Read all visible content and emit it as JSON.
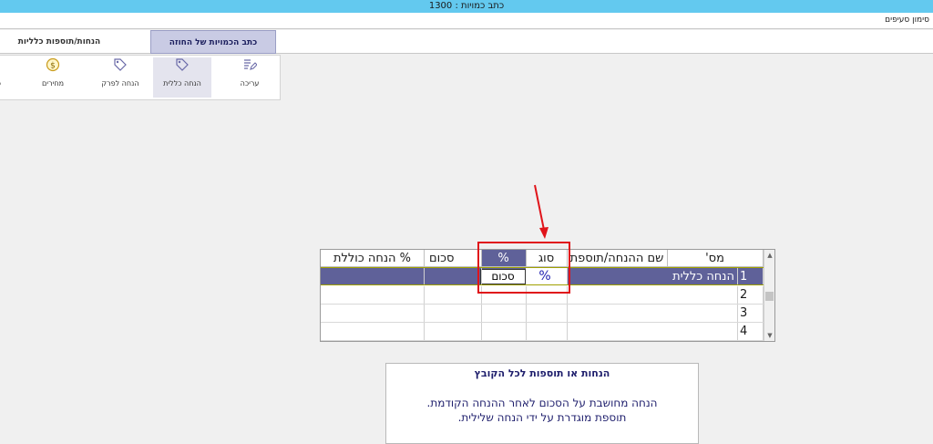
{
  "window": {
    "title": "כתב כמויות : 1300"
  },
  "menu": {
    "item": "סימון סעיפים"
  },
  "tabs": [
    {
      "label": "כתב הכמויות של החוזה",
      "active": true
    },
    {
      "label": "הנחות/תוספות כלליות",
      "active": false
    }
  ],
  "ribbon": {
    "items": [
      {
        "label": "עריכה",
        "icon": "edit-icon"
      },
      {
        "label": "הנחה כללית",
        "icon": "tag-icon"
      },
      {
        "label": "הנחה לפרק",
        "icon": "tag-icon"
      },
      {
        "label": "מחירים",
        "icon": "dollar-icon"
      },
      {
        "label": "פ",
        "icon": "cut-off"
      }
    ]
  },
  "grid": {
    "headers": {
      "num": "מס'",
      "name": "שם ההנחה/תוספת",
      "type": "סוג",
      "pct": "%",
      "amount": "סכום",
      "total": "% הנחה כוללת"
    },
    "rows": [
      {
        "num": "1",
        "name": "הנחה כללית",
        "type": "%",
        "pct": "",
        "amount": "",
        "total": ""
      },
      {
        "num": "2",
        "name": "",
        "type": "",
        "pct": "",
        "amount": "",
        "total": ""
      },
      {
        "num": "3",
        "name": "",
        "type": "",
        "pct": "",
        "amount": "",
        "total": ""
      },
      {
        "num": "4",
        "name": "",
        "type": "",
        "pct": "",
        "amount": "",
        "total": ""
      }
    ],
    "dropdown_value": "סכום"
  },
  "info": {
    "title": "הנחות או תוספות לכל הקובץ",
    "line1": "הנחה מחושבת על הסכום לאחר ההנחה הקודמת.",
    "line2": "תוספת מוגדרת  על ידי הנחה שלילית."
  },
  "colors": {
    "accent": "#5f6199",
    "titlebar": "#63c9ef",
    "annotation": "#e0141a"
  }
}
